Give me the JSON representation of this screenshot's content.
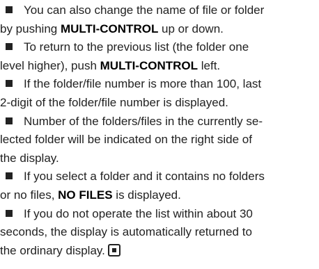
{
  "notes": [
    {
      "line1": "You can also change the name of file or folder",
      "line2_pre": "by pushing ",
      "line2_kw": "MULTI-CONTROL",
      "line2_post": " up or down."
    },
    {
      "line1": "To return to the previous list (the folder one",
      "line2_pre": "level higher), push ",
      "line2_kw": "MULTI-CONTROL",
      "line2_post": " left."
    },
    {
      "line1": "If the folder/file number is more than 100, last",
      "line2": "2-digit of the folder/file number is displayed."
    },
    {
      "line1": "Number of the folders/files in the currently se-",
      "line2": "lected folder will be indicated on the right side of",
      "line3": "the display."
    },
    {
      "line1": "If you select a folder and it contains no folders",
      "line2_pre": "or no files, ",
      "line2_kw": "NO FILES",
      "line2_post": " is displayed."
    },
    {
      "line1": "If you do not operate the list within about 30",
      "line2": "seconds, the display is automatically returned to",
      "line3": "the ordinary display."
    }
  ],
  "icons": {
    "bullet": "square-bullet-icon",
    "end_mark": "end-of-section-icon"
  },
  "colors": {
    "text": "#222222",
    "background": "#ffffff"
  }
}
